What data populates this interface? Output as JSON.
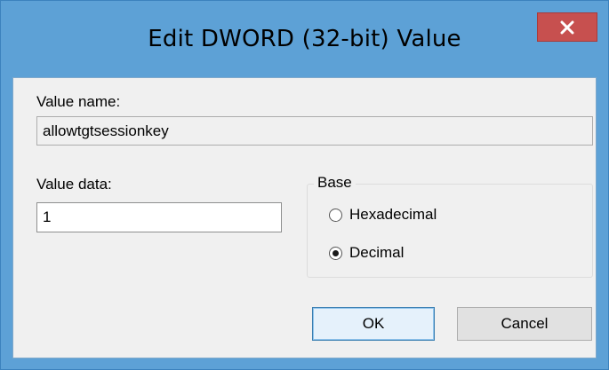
{
  "window": {
    "title": "Edit DWORD (32-bit) Value",
    "close_label": "x"
  },
  "value_name": {
    "label": "Value name:",
    "value": "allowtgtsessionkey"
  },
  "value_data": {
    "label": "Value data:",
    "value": "1"
  },
  "base": {
    "title": "Base",
    "options": [
      {
        "label": "Hexadecimal",
        "checked": false
      },
      {
        "label": "Decimal",
        "checked": true
      }
    ]
  },
  "buttons": {
    "ok_label": "OK",
    "cancel_label": "Cancel"
  },
  "colors": {
    "frame": "#5da1d6",
    "close_button": "#c7504f",
    "client_bg": "#f0f0f0"
  }
}
